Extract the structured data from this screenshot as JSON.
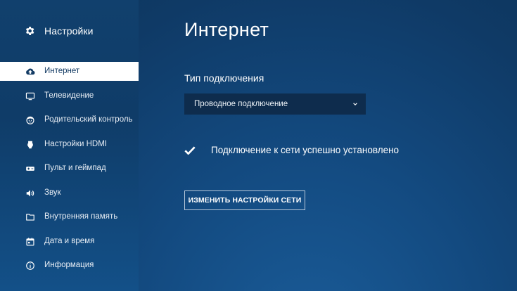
{
  "sidebar": {
    "title": "Настройки",
    "title_icon": "gear-icon",
    "items": [
      {
        "label": "Интернет",
        "icon": "cloud-icon",
        "active": true
      },
      {
        "label": "Телевидение",
        "icon": "tv-icon",
        "active": false
      },
      {
        "label": "Родительский контроль",
        "icon": "child-face-icon",
        "active": false
      },
      {
        "label": "Настройки HDMI",
        "icon": "hdmi-icon",
        "active": false
      },
      {
        "label": "Пульт и геймпад",
        "icon": "gamepad-icon",
        "active": false
      },
      {
        "label": "Звук",
        "icon": "speaker-icon",
        "active": false
      },
      {
        "label": "Внутренняя память",
        "icon": "folder-icon",
        "active": false
      },
      {
        "label": "Дата и время",
        "icon": "calendar-icon",
        "active": false
      },
      {
        "label": "Информация",
        "icon": "info-icon",
        "active": false
      }
    ]
  },
  "main": {
    "title": "Интернет",
    "connection_type_label": "Тип подключения",
    "connection_type_value": "Проводное подключение",
    "status_text": "Подключение к сети успешно установлено",
    "change_button_label": "ИЗМЕНИТЬ НАСТРОЙКИ СЕТИ"
  },
  "colors": {
    "background": "#134a80",
    "sidebar": "#0f3c68",
    "active_item_bg": "#ffffff",
    "active_item_text": "#123a63",
    "select_bg": "#0e2c4d"
  }
}
